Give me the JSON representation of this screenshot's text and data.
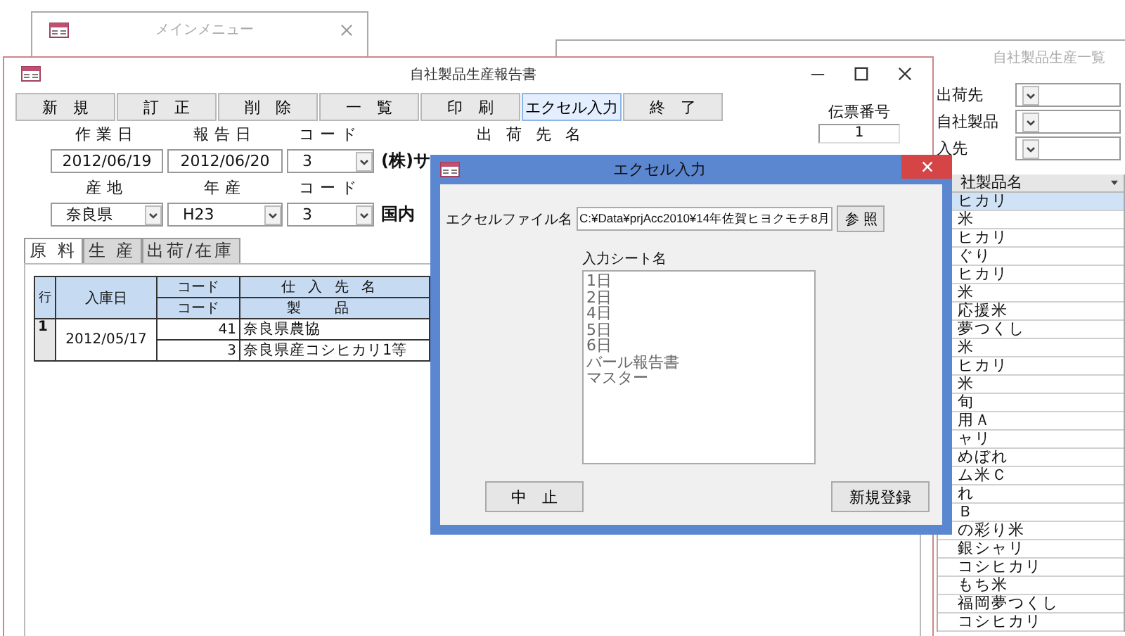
{
  "main_menu": {
    "title": "メインメニュー"
  },
  "list_window": {
    "title": "自社製品生産一覧",
    "filters": [
      {
        "label": "出荷先"
      },
      {
        "label": "自社製品"
      },
      {
        "label": "入先"
      }
    ],
    "grid": {
      "header": "社製品名",
      "rows": [
        {
          "text": "ヒカリ",
          "selected": true
        },
        {
          "text": "米",
          "selected": false
        },
        {
          "text": "ヒカリ",
          "selected": false
        },
        {
          "text": "ぐり",
          "selected": false
        },
        {
          "text": "ヒカリ",
          "selected": false
        },
        {
          "text": "米",
          "selected": false
        },
        {
          "text": "応援米",
          "selected": false
        },
        {
          "text": "夢つくし",
          "selected": false
        },
        {
          "text": "米",
          "selected": false
        },
        {
          "text": "ヒカリ",
          "selected": false
        },
        {
          "text": "米",
          "selected": false
        },
        {
          "text": "旬",
          "selected": false
        },
        {
          "text": "用Ａ",
          "selected": false
        },
        {
          "text": "ャリ",
          "selected": false
        },
        {
          "text": "めぼれ",
          "selected": false
        },
        {
          "text": "ム米Ｃ",
          "selected": false
        },
        {
          "text": "れ",
          "selected": false
        },
        {
          "text": "Ｂ",
          "selected": false
        },
        {
          "text": "の彩り米",
          "selected": false
        },
        {
          "text": "銀シャリ",
          "selected": false
        },
        {
          "text": "コシヒカリ",
          "selected": false
        },
        {
          "text": "もち米",
          "selected": false
        },
        {
          "text": "福岡夢つくし",
          "selected": false
        },
        {
          "text": "コシヒカリ",
          "selected": false
        }
      ]
    }
  },
  "report": {
    "title": "自社製品生産報告書",
    "toolbar": [
      {
        "label": "新　規",
        "selected": false
      },
      {
        "label": "訂　正",
        "selected": false
      },
      {
        "label": "削　除",
        "selected": false
      },
      {
        "label": "一　覧",
        "selected": false
      },
      {
        "label": "印　刷",
        "selected": false
      },
      {
        "label": "エクセル入力",
        "selected": true
      },
      {
        "label": "終　了",
        "selected": false
      }
    ],
    "slip_label": "伝票番号",
    "slip_number": "1",
    "row1_labels": [
      "作業日",
      "報告日",
      "コード",
      "出荷先名"
    ],
    "work_date": "2012/06/19",
    "report_date": "2012/06/20",
    "ship_code": "3",
    "ship_name": "(株)サ",
    "row2_labels": [
      "産地",
      "年産",
      "コード"
    ],
    "origin": "奈良県",
    "crop_year": "H23",
    "product_code": "3",
    "product_name": "国内",
    "tabs": [
      {
        "label": "原 料",
        "selected": true
      },
      {
        "label": "生 産",
        "selected": false
      },
      {
        "label": "出荷/在庫",
        "selected": false
      }
    ],
    "table": {
      "head_row": "行",
      "head_date": "入庫日",
      "head_code_1": "コード",
      "head_supplier": "仕入先名",
      "head_code_2": "コード",
      "head_product": "製品",
      "rows": [
        {
          "row": "1",
          "date": "2012/05/17",
          "supplier_code": "41",
          "supplier": "奈良県農協",
          "product_code": "3",
          "product": "奈良県産コシヒカリ1等"
        }
      ]
    }
  },
  "dialog": {
    "title": "エクセル入力",
    "file_label": "エクセルファイル名",
    "file_path": "C:¥Data¥prjAcc2010¥14年佐賀ヒヨクモチ8月",
    "browse": "参 照",
    "sheet_label": "入力シート名",
    "sheets": [
      "1日",
      "2日",
      "4日",
      "5日",
      "6日",
      "バール報告書",
      "マスター"
    ],
    "cancel": "中　止",
    "submit": "新規登録"
  }
}
